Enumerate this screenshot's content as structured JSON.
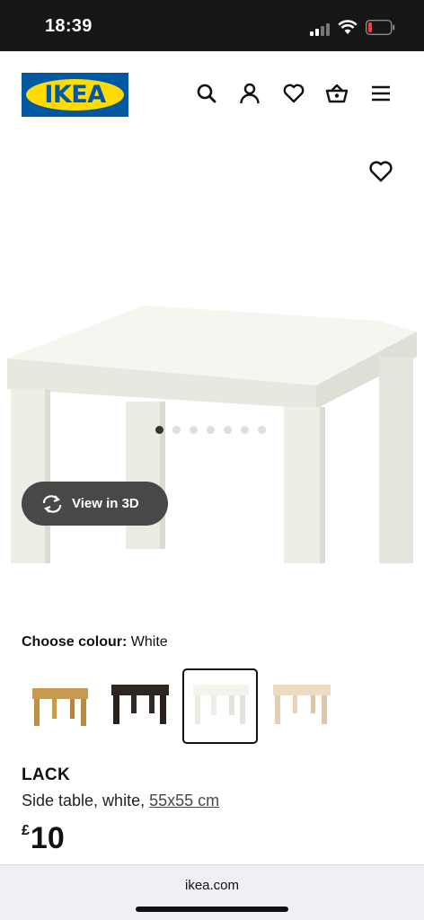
{
  "status_bar": {
    "time": "18:39"
  },
  "header": {
    "logo_text": "IKEA",
    "icons": [
      "search-icon",
      "account-icon",
      "favourites-icon",
      "shopping-bag-icon",
      "menu-icon"
    ]
  },
  "gallery": {
    "view_3d_label": "View in 3D",
    "image_count": 7,
    "active_index": 0
  },
  "colour_picker": {
    "label": "Choose colour:",
    "selected": "White",
    "options": [
      {
        "colour": "#c99a4e",
        "selected": false
      },
      {
        "colour": "#2e2420",
        "selected": false
      },
      {
        "colour": "#f4f3ee",
        "selected": true
      },
      {
        "colour": "#e7d3b8",
        "selected": false
      }
    ]
  },
  "product": {
    "name": "LACK",
    "description": "Side table, white,",
    "size_link": "55x55 cm",
    "currency": "£",
    "price": "10"
  },
  "browser": {
    "url": "ikea.com"
  },
  "colors": {
    "ikea_blue": "#0058a3",
    "ikea_yellow": "#ffdb00"
  }
}
